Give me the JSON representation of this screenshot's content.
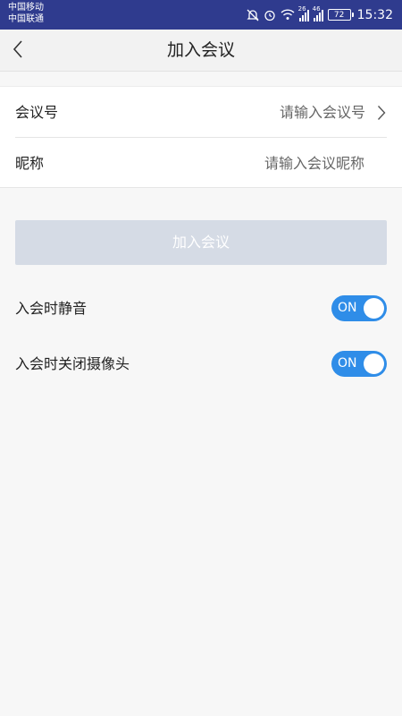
{
  "status_bar": {
    "carrier_1": "中国移动",
    "carrier_2": "中国联通",
    "signal_1_tag": "26",
    "signal_2_tag": "46",
    "battery": "72",
    "time": "15:32"
  },
  "header": {
    "title": "加入会议"
  },
  "form": {
    "meeting_id": {
      "label": "会议号",
      "placeholder": "请输入会议号"
    },
    "nickname": {
      "label": "昵称",
      "placeholder": "请输入会议昵称"
    }
  },
  "join_button": {
    "label": "加入会议"
  },
  "options": [
    {
      "label": "入会时静音",
      "state_text": "ON"
    },
    {
      "label": "入会时关闭摄像头",
      "state_text": "ON"
    }
  ],
  "colors": {
    "status_bar_bg": "#2f3b8e",
    "toggle_on": "#2f8de8",
    "button_disabled": "#d5dbe5"
  }
}
